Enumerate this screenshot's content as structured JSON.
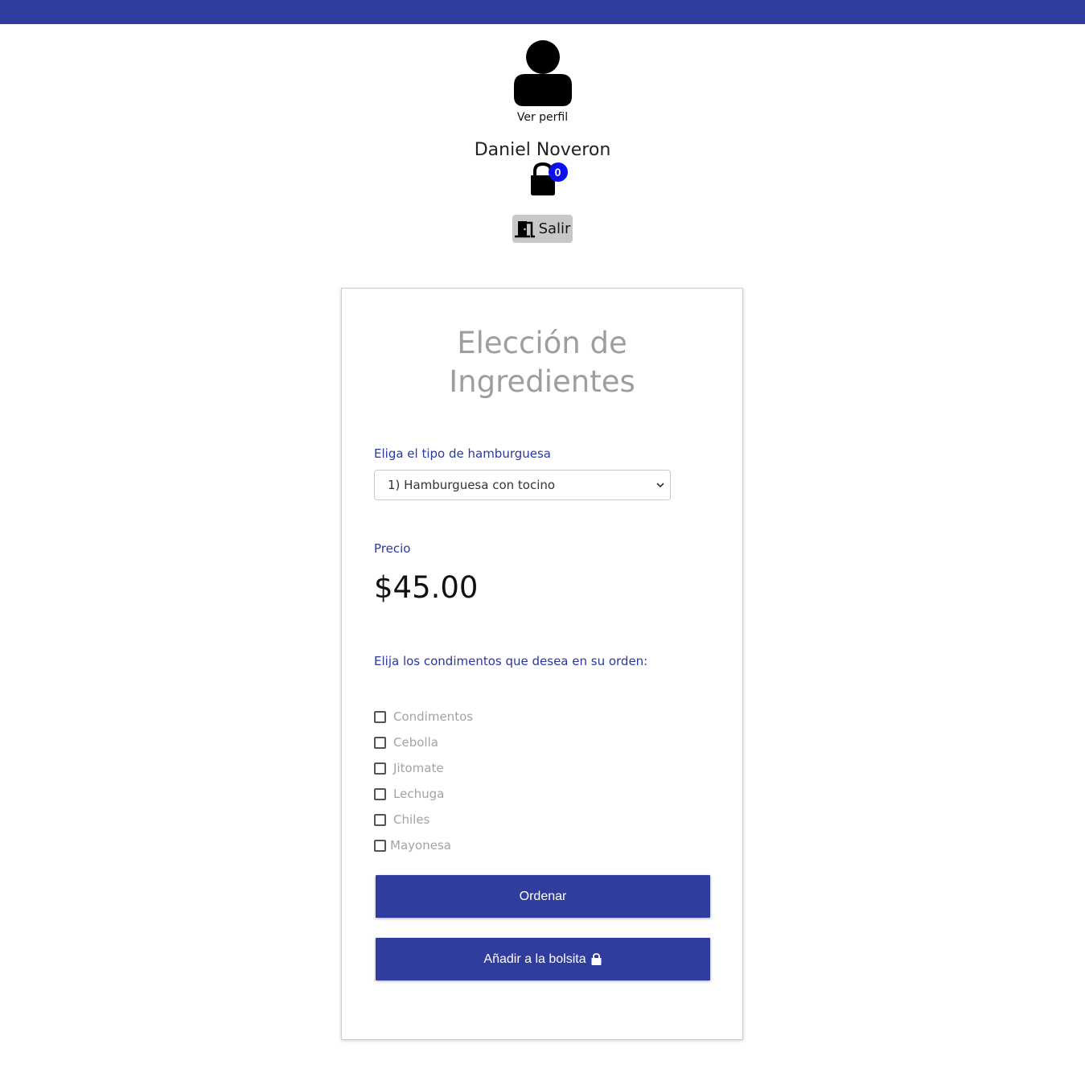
{
  "profile": {
    "view_profile_label": "Ver perfil",
    "user_name": "Daniel Noveron",
    "bag_count": "0",
    "logout_label": "Salir"
  },
  "form": {
    "title": "Elección de Ingredientes",
    "burger_type_label": "Eliga el tipo de hamburguesa",
    "burger_type_selected": "1) Hamburguesa con tocino",
    "price_label": "Precio",
    "price_value": "$45.00",
    "condiments_label": "Elija los condimentos que desea en su orden:",
    "condiments": [
      {
        "label": "Condimentos",
        "checked": false
      },
      {
        "label": "Cebolla",
        "checked": false
      },
      {
        "label": "Jitomate",
        "checked": false
      },
      {
        "label": "Lechuga",
        "checked": false
      },
      {
        "label": "Chiles",
        "checked": false
      },
      {
        "label": "Mayonesa",
        "checked": false
      }
    ],
    "order_button_label": "Ordenar",
    "add_to_bag_button_label": "Añadir a la bolsita"
  },
  "colors": {
    "primary": "#303d9d",
    "badge": "#0b10ee",
    "logout_bg": "#c8c8c8",
    "label_text": "#2b37a0",
    "muted_text": "#a3a3a3"
  },
  "icons": {
    "avatar": "user-icon",
    "bag": "shopping-bag-icon",
    "logout": "door-exit-icon",
    "select": "chevron-down-icon",
    "add_to_bag": "shopping-bag-icon"
  }
}
